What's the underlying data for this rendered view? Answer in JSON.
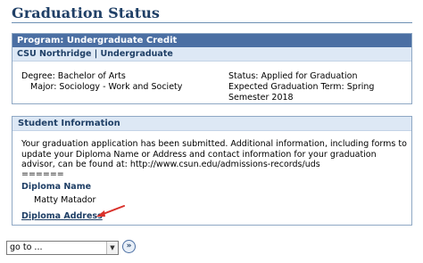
{
  "page": {
    "title": "Graduation Status"
  },
  "program": {
    "header": "Program: Undergraduate Credit",
    "subheader": "CSU Northridge | Undergraduate",
    "degree": "Degree: Bachelor of Arts",
    "major": "Major: Sociology - Work and Society",
    "status": "Status: Applied for Graduation",
    "expected_term": "Expected Graduation Term: Spring Semester 2018"
  },
  "student_info": {
    "header": "Student Information",
    "message": "Your graduation application has been submitted. Additional information, including forms to update your Diploma Name or Address and contact information for your graduation advisor, can be found at: http://www.csun.edu/admissions-records/uds",
    "separator": "======",
    "diploma_name_label": "Diploma Name",
    "diploma_name_value": "Matty Matador",
    "diploma_address_link": "Diploma Address"
  },
  "navigation": {
    "goto_selected": "go to ...",
    "goto_button": "»"
  },
  "colors": {
    "title": "#1f3f66",
    "header_bg": "#4b6fa3",
    "subheader_bg": "#dde8f5",
    "annotation_arrow": "#d9312b"
  },
  "icons": {
    "arrow": "annotation-arrow-icon",
    "dropdown": "chevron-down-icon",
    "go": "double-chevron-right-icon"
  }
}
